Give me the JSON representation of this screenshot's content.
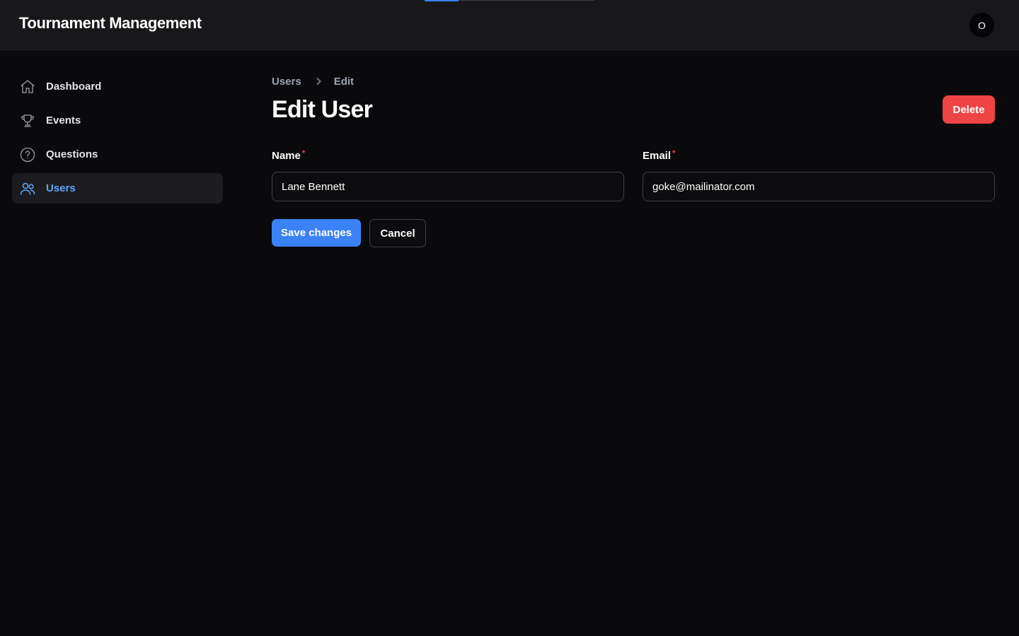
{
  "app": {
    "title": "Tournament Management",
    "avatar_initial": "O"
  },
  "loading_bar": {
    "progress": 0.2
  },
  "sidebar": {
    "items": [
      {
        "label": "Dashboard",
        "icon": "home-icon",
        "active": false
      },
      {
        "label": "Events",
        "icon": "trophy-icon",
        "active": false
      },
      {
        "label": "Questions",
        "icon": "question-circle-icon",
        "active": false
      },
      {
        "label": "Users",
        "icon": "users-icon",
        "active": true
      }
    ]
  },
  "breadcrumb": {
    "parent": "Users",
    "current": "Edit"
  },
  "page": {
    "title": "Edit User",
    "delete_label": "Delete"
  },
  "form": {
    "name": {
      "label": "Name",
      "required_mark": "*",
      "value": "Lane Bennett"
    },
    "email": {
      "label": "Email",
      "required_mark": "*",
      "value": "goke@mailinator.com"
    }
  },
  "actions": {
    "save_label": "Save changes",
    "cancel_label": "Cancel"
  },
  "colors": {
    "accent": "#3b82f6",
    "danger": "#ef4444",
    "active_nav": "#60a5fa",
    "background": "#0a0a0c"
  }
}
